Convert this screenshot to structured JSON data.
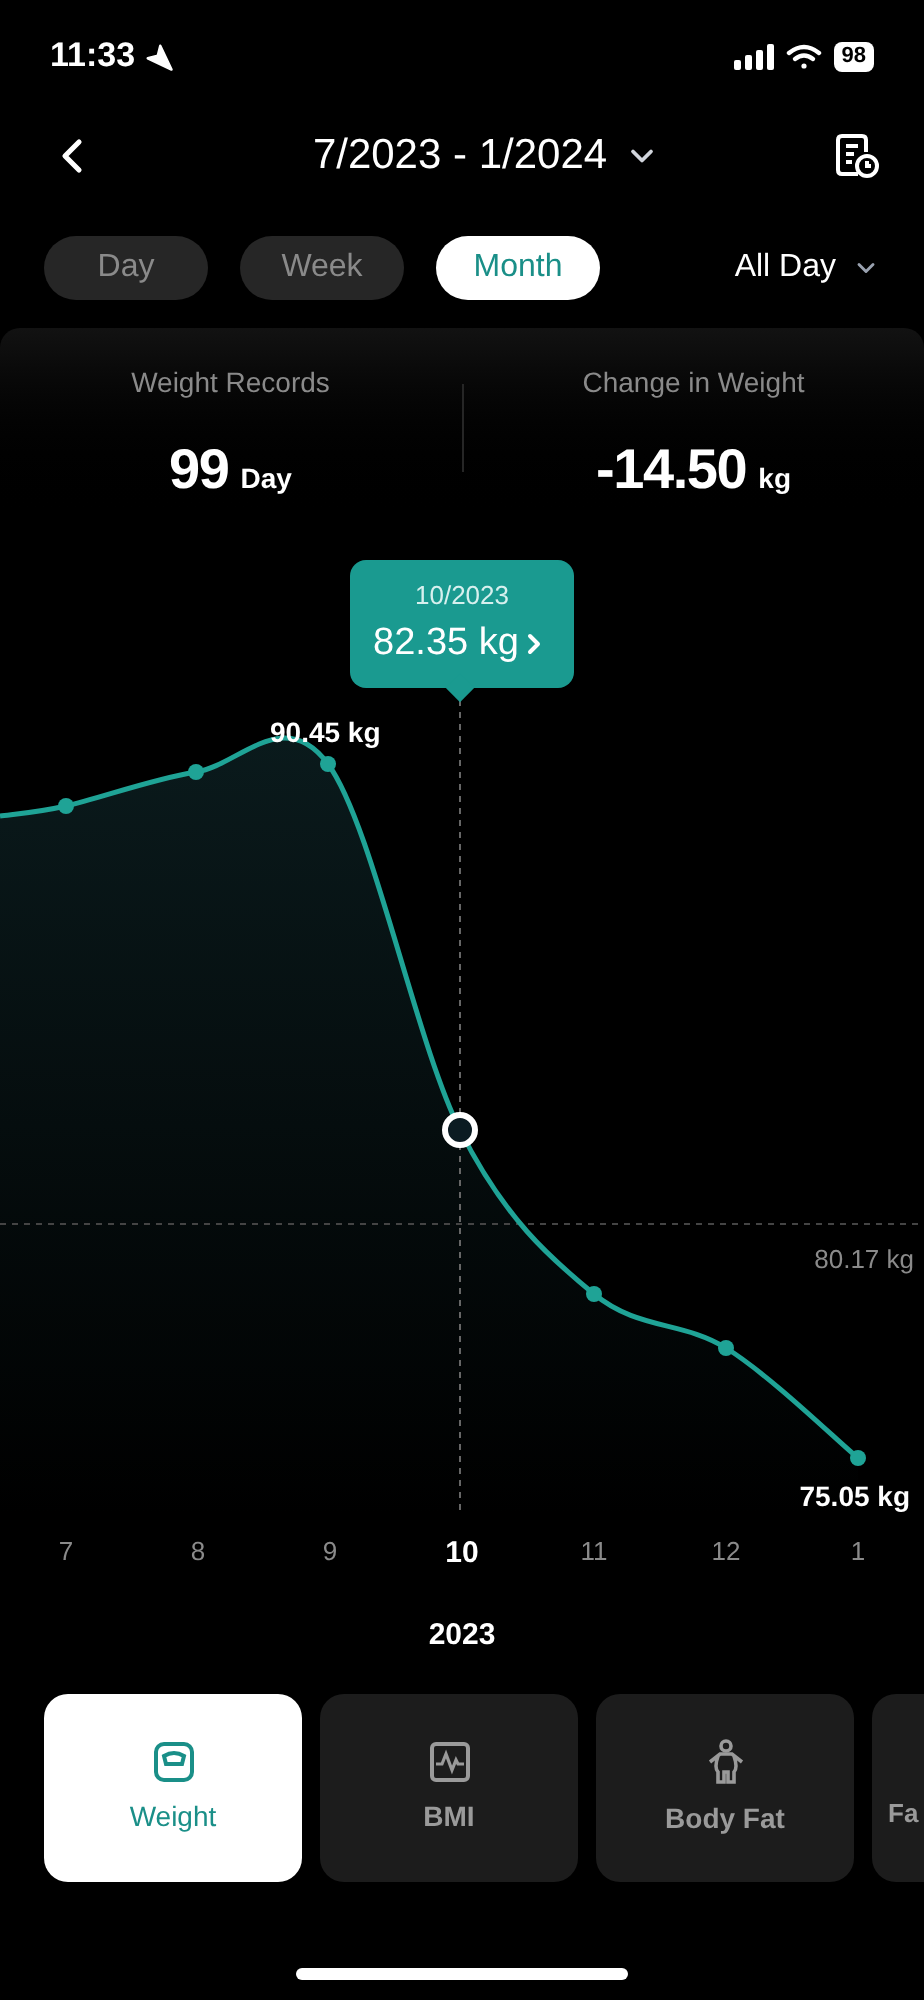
{
  "status_bar": {
    "time": "11:33",
    "battery": "98"
  },
  "header": {
    "title": "7/2023 - 1/2024"
  },
  "range_tabs": [
    {
      "label": "Day",
      "selected": false
    },
    {
      "label": "Week",
      "selected": false
    },
    {
      "label": "Month",
      "selected": true
    }
  ],
  "time_filter": {
    "label": "All Day"
  },
  "stats": [
    {
      "label": "Weight Records",
      "value": "99",
      "unit": "Day"
    },
    {
      "label": "Change in Weight",
      "value": "-14.50",
      "unit": "kg"
    }
  ],
  "chart": {
    "tooltip": {
      "period": "10/2023",
      "value": "82.35 kg"
    },
    "max_label": "90.45 kg",
    "average_label": "80.17 kg",
    "min_label": "75.05 kg",
    "x_labels": [
      {
        "label": "7",
        "selected": false
      },
      {
        "label": "8",
        "selected": false
      },
      {
        "label": "9",
        "selected": false
      },
      {
        "label": "10",
        "selected": true
      },
      {
        "label": "11",
        "selected": false
      },
      {
        "label": "12",
        "selected": false
      },
      {
        "label": "1",
        "selected": false
      }
    ],
    "year": "2023"
  },
  "metric_cards": [
    {
      "label": "Weight",
      "selected": true,
      "kind": "scale"
    },
    {
      "label": "BMI",
      "selected": false,
      "kind": "pulse"
    },
    {
      "label": "Body Fat",
      "selected": false,
      "kind": "body"
    },
    {
      "label": "Fa",
      "selected": false,
      "kind": "partial"
    }
  ]
}
